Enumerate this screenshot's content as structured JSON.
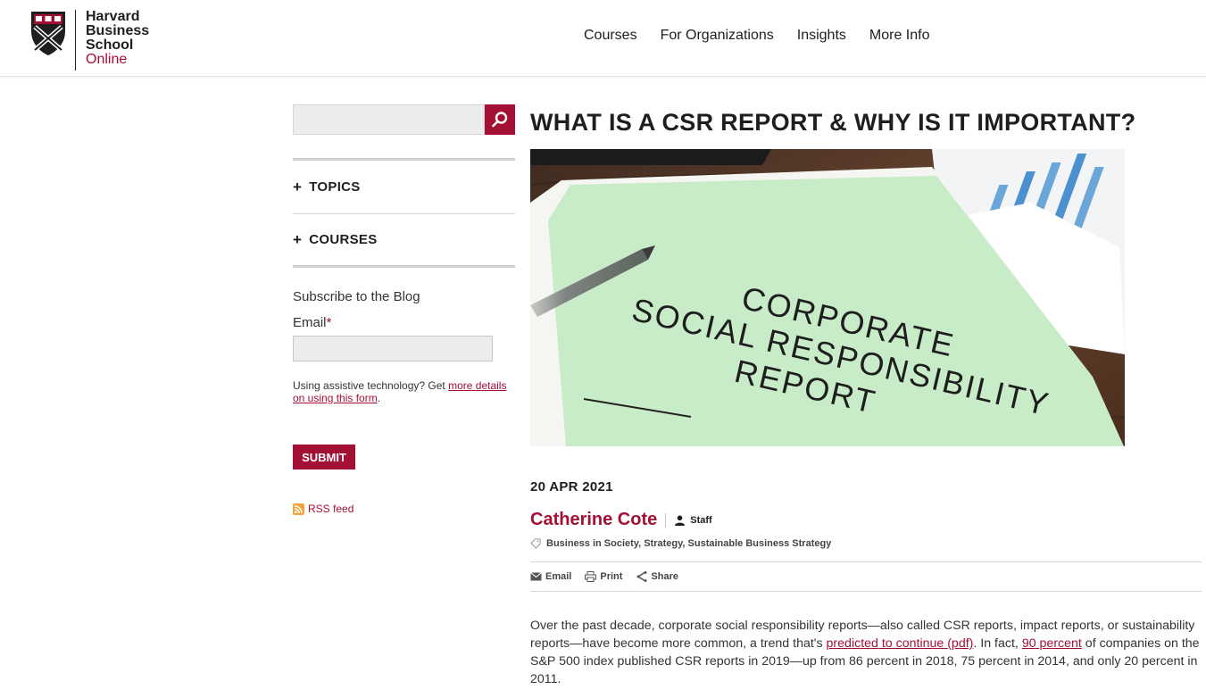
{
  "header": {
    "logo": {
      "line1": "Harvard",
      "line2": "Business",
      "line3": "School",
      "line4": "Online"
    },
    "nav": [
      "Courses",
      "For Organizations",
      "Insights",
      "More Info"
    ]
  },
  "sidebar": {
    "search": {
      "placeholder": "",
      "value": ""
    },
    "menu": [
      {
        "plus": "+",
        "label": "TOPICS"
      },
      {
        "plus": "+",
        "label": "COURSES"
      }
    ],
    "subscribe_title": "Subscribe to the Blog",
    "email_label": "Email",
    "email_required": "*",
    "assist_text": "Using assistive technology? Get ",
    "assist_link": "more details on using this form",
    "assist_end": ".",
    "submit_label": "SUBMIT",
    "rss_label": "RSS feed"
  },
  "article": {
    "title": "WHAT IS A CSR REPORT & WHY IS IT IMPORTANT?",
    "hero_text": {
      "line1": "CORPORATE",
      "line2": "SOCIAL RESPONSIBILITY",
      "line3": "REPORT"
    },
    "date": "20 APR 2021",
    "author": "Catherine Cote",
    "author_role": "Staff",
    "tags": "Business in Society, Strategy, Sustainable Business Strategy",
    "share": {
      "email": "Email",
      "print": "Print",
      "share": "Share"
    },
    "body": {
      "p1": "Over the past decade, corporate social responsibility reports—also called CSR reports, impact reports, or sustainability reports—have become more common, a trend that's ",
      "link1": "predicted to continue (pdf)",
      "p2": ". In fact, ",
      "link2": "90 percent",
      "p3": " of companies on the S&P 500 index published CSR reports in 2019—up from 86 percent in 2018, 75 percent in 2014, and only 20 percent in 2011."
    }
  },
  "colors": {
    "brand": "#a41034",
    "text": "#1e1e1e",
    "rss": "#f2a33a"
  },
  "icons": {
    "search": "search-icon",
    "tag": "tag-icon",
    "user": "user-icon",
    "email": "envelope-icon",
    "print": "printer-icon",
    "share": "share-icon",
    "rss": "rss-icon",
    "shield": "shield-icon"
  }
}
